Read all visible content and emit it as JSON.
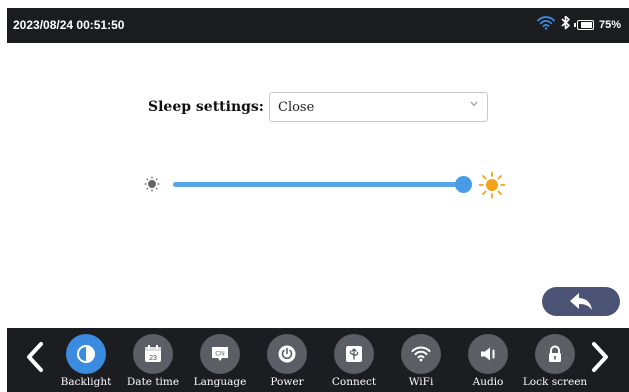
{
  "status_bar": {
    "datetime": "2023/08/24 00:51:50",
    "battery_percent": "75%",
    "icons": [
      "wifi-icon",
      "bluetooth-icon",
      "battery-icon"
    ]
  },
  "sleep": {
    "label": "Sleep settings:",
    "value": "Close"
  },
  "brightness": {
    "level": 1.0
  },
  "toolbar": {
    "items": [
      {
        "label": "Backlight",
        "icon": "backlight-icon",
        "active": true
      },
      {
        "label": "Date time",
        "icon": "calendar-icon",
        "date_text": "23"
      },
      {
        "label": "Language",
        "icon": "language-icon",
        "badge_text": "CN"
      },
      {
        "label": "Power",
        "icon": "power-icon"
      },
      {
        "label": "Connect",
        "icon": "usb-icon"
      },
      {
        "label": "WiFi",
        "icon": "wifi-icon"
      },
      {
        "label": "Audio",
        "icon": "speaker-icon"
      },
      {
        "label": "Lock screen",
        "icon": "lock-icon"
      }
    ]
  },
  "colors": {
    "accent": "#3b8ce0",
    "sun_large": "#f5a21b",
    "toolbar_bg": "#1c1d21",
    "back_button": "#4b5475"
  }
}
